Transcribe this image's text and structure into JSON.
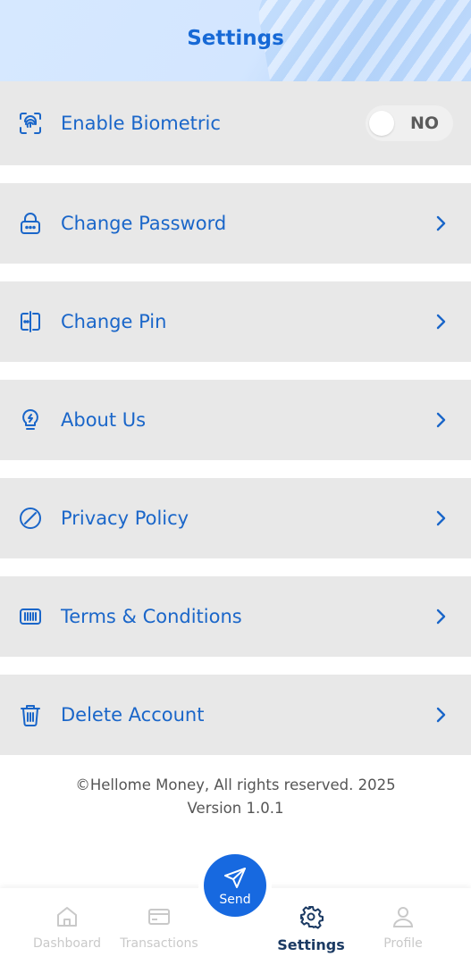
{
  "header": {
    "title": "Settings"
  },
  "settings": {
    "biometric": {
      "label": "Enable Biometric",
      "toggle_state": "NO",
      "enabled": false
    },
    "items": [
      {
        "label": "Change Password",
        "icon": "lock-icon"
      },
      {
        "label": "Change Pin",
        "icon": "pin-icon"
      },
      {
        "label": "About Us",
        "icon": "lightbulb-icon"
      },
      {
        "label": "Privacy Policy",
        "icon": "prohibited-icon"
      },
      {
        "label": "Terms & Conditions",
        "icon": "document-icon"
      },
      {
        "label": "Delete Account",
        "icon": "trash-icon"
      }
    ]
  },
  "footer": {
    "copyright": "©Hellome Money, All rights reserved. 2025",
    "version": "Version 1.0.1"
  },
  "nav": {
    "send": "Send",
    "items": [
      {
        "label": "Dashboard",
        "icon": "home-icon"
      },
      {
        "label": "Transactions",
        "icon": "card-icon"
      },
      {
        "label": "Settings",
        "icon": "gear-icon",
        "active": true
      },
      {
        "label": "Profile",
        "icon": "user-icon"
      }
    ]
  },
  "colors": {
    "accent": "#1769d6",
    "row_bg": "#e8e8e8",
    "nav_active": "#1b3a63",
    "nav_inactive": "#c9c9c9"
  }
}
